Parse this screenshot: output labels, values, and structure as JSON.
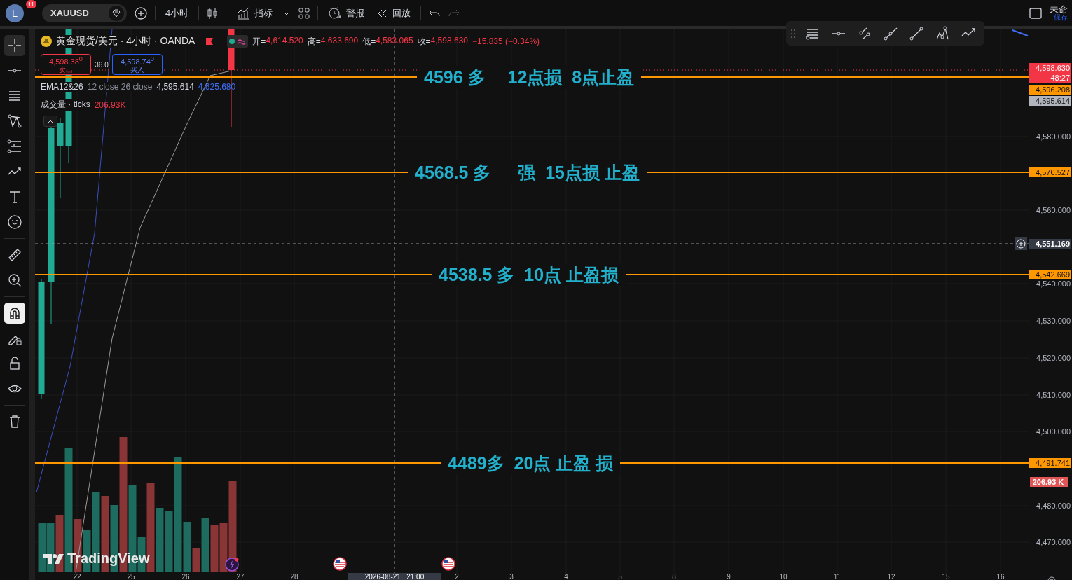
{
  "top_bar": {
    "avatar": {
      "letter": "L",
      "badge": "11"
    },
    "symbol": "XAUUSD",
    "interval": "4小时",
    "indicators": "指标",
    "alert": "警报",
    "replay": "回放",
    "layout_name": "未命",
    "save_hint": "保存"
  },
  "left_toolbar": {
    "groups": [
      [
        {
          "kind": "crosshair",
          "selected": true
        },
        {
          "kind": "dot-line",
          "selected": false
        },
        {
          "kind": "lines",
          "selected": false
        },
        {
          "kind": "pattern",
          "selected": false
        },
        {
          "kind": "fib",
          "selected": false
        },
        {
          "kind": "path",
          "selected": false
        },
        {
          "kind": "text",
          "selected": false
        },
        {
          "kind": "emoji",
          "selected": false
        }
      ],
      [
        {
          "kind": "ruler",
          "selected": false
        },
        {
          "kind": "zoom",
          "selected": false
        }
      ],
      [
        {
          "kind": "magnet",
          "selected": true
        },
        {
          "kind": "lock-draw",
          "selected": false
        },
        {
          "kind": "lock",
          "selected": false
        },
        {
          "kind": "eye",
          "selected": false
        }
      ],
      [
        {
          "kind": "trash",
          "selected": false
        }
      ]
    ]
  },
  "legend": {
    "title": "黄金现货/美元 · 4小时 · OANDA",
    "ohlc": [
      {
        "label": "开=",
        "value": "4,614.520"
      },
      {
        "label": "高=",
        "value": "4,633.690"
      },
      {
        "label": "低=",
        "value": "4,583.065"
      },
      {
        "label": "收=",
        "value": "4,598.630"
      }
    ],
    "change": "−15.835 (−0.34%)",
    "sell": {
      "price": "4,598.38",
      "sup": "0",
      "label": "卖出"
    },
    "spread": "36.0",
    "buy": {
      "price": "4,598.74",
      "sup": "0",
      "label": "买入"
    },
    "ema": {
      "name": "EMA12&26",
      "params": "12 close 26 close",
      "values": [
        "4,595.614",
        "4,625.680"
      ]
    },
    "volume": {
      "name": "成交量 · ticks",
      "value": "206.93K"
    }
  },
  "annotations": [
    "4596 多　 12点损  8点止盈",
    "4568.5 多　  强  15点损 止盈",
    "4538.5 多  10点 止盈损",
    "4489多  20点 止盈 损"
  ],
  "price_axis": {
    "ticks": [
      "4,580.000",
      "4,560.000",
      "4,540.000",
      "4,530.000",
      "4,520.000",
      "4,510.000",
      "4,500.000",
      "4,480.000",
      "4,470.000"
    ],
    "tags": [
      {
        "kind": "last",
        "text": "4,598.630",
        "countdown": "48:27"
      },
      {
        "kind": "level",
        "text": "4,596.208"
      },
      {
        "kind": "ema",
        "text": "4,595.614"
      },
      {
        "kind": "level",
        "text": "4,570.527"
      },
      {
        "kind": "crosshair",
        "text": "4,551.169"
      },
      {
        "kind": "level",
        "text": "4,542.669"
      },
      {
        "kind": "level",
        "text": "4,491.741"
      },
      {
        "kind": "volume",
        "text": "206.93 K"
      }
    ]
  },
  "time_axis": {
    "labels": [
      "22",
      "25",
      "26",
      "27",
      "28",
      "2",
      "3",
      "4",
      "5",
      "8",
      "9",
      "10",
      "11",
      "12",
      "15",
      "16"
    ],
    "crosshair_time": "2026-08-21   21:00"
  },
  "logo": "TradingView"
}
